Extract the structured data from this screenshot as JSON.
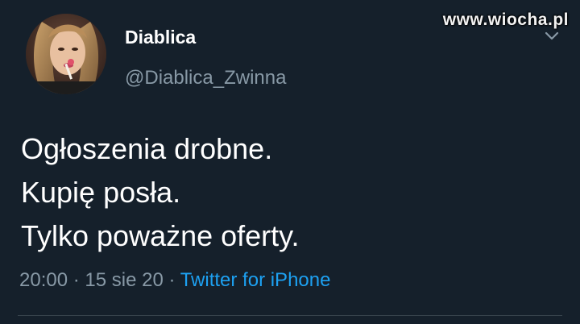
{
  "watermark": "www.wiocha.pl",
  "tweet": {
    "display_name": "Diablica",
    "handle": "@Diablica_Zwinna",
    "avatar_icon": "user-avatar-photo",
    "menu_icon": "chevron-down-icon",
    "body_lines": [
      "Ogłoszenia drobne.",
      "Kupię posła.",
      "Tylko poważne oferty."
    ],
    "time": "20:00",
    "separator": " · ",
    "date": "15 sie 20",
    "source": "Twitter for iPhone"
  },
  "colors": {
    "background": "#15202b",
    "primary_text": "#ffffff",
    "secondary_text": "#8899a6",
    "link": "#1da1f2",
    "divider": "#38444d"
  }
}
